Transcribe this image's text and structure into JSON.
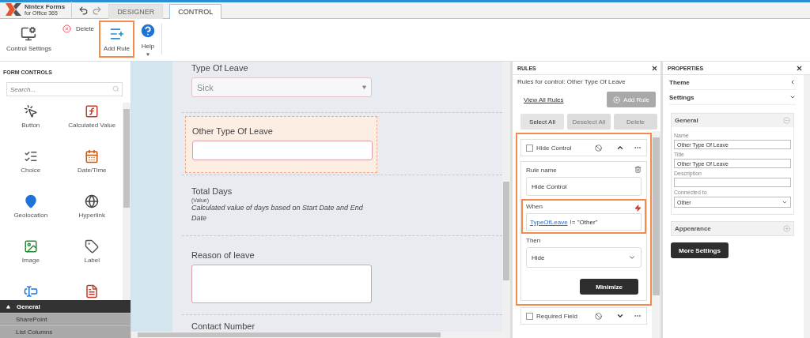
{
  "app": {
    "logo": {
      "name": "Nintex Forms",
      "subtitle": "for Office 365"
    },
    "tabs": [
      {
        "label": "DESIGNER",
        "selected": false
      },
      {
        "label": "CONTROL",
        "selected": true
      }
    ]
  },
  "ribbon": {
    "buttons": [
      {
        "kind": "settings",
        "label": "Control Settings",
        "highlighted": false
      },
      {
        "kind": "delete",
        "label": "Delete",
        "highlighted": false
      },
      {
        "kind": "add_rule",
        "label": "Add Rule",
        "highlighted": true
      },
      {
        "kind": "help",
        "label": "Help",
        "highlighted": false
      }
    ]
  },
  "form_controls": {
    "title": "FORM CONTROLS",
    "search": {
      "placeholder": "Search..."
    },
    "items": [
      {
        "kind": "button",
        "label": "Button"
      },
      {
        "kind": "calculated",
        "label": "Calculated Value"
      },
      {
        "kind": "choice",
        "label": "Choice"
      },
      {
        "kind": "datetime",
        "label": "Date/Time"
      },
      {
        "kind": "geolocation",
        "label": "Geolocation"
      },
      {
        "kind": "hyperlink",
        "label": "Hyperlink"
      },
      {
        "kind": "image",
        "label": "Image"
      },
      {
        "kind": "label",
        "label": "Label"
      },
      {
        "kind": "textbox"
      },
      {
        "kind": "pdf"
      }
    ],
    "category": {
      "label": "General",
      "expanded": true,
      "items": [
        "SharePoint",
        "List Columns"
      ]
    }
  },
  "form": {
    "sections": [
      {
        "kind": "select",
        "label": "Type Of Leave",
        "value": "Sick",
        "selected": false
      },
      {
        "kind": "text",
        "label": "Other Type Of Leave",
        "selected": true
      },
      {
        "kind": "calculated",
        "label": "Total Days",
        "hint": "(Value)",
        "description": "Calculated value of days based on Start Date and End Date",
        "selected": false
      },
      {
        "kind": "textarea",
        "label": "Reason of leave",
        "selected": false
      },
      {
        "kind": "heading",
        "label": "Contact Number",
        "selected": false
      }
    ]
  },
  "rules": {
    "title": "RULES",
    "subtitle": "Rules for control: Other Type Of Leave",
    "view_all": "View All Rules",
    "add_rule": {
      "label": "Add Rule",
      "disabled": true
    },
    "actions": [
      {
        "label": "Select All",
        "disabled": false
      },
      {
        "label": "Deselect All",
        "disabled": true
      },
      {
        "label": "Delete",
        "disabled": true
      }
    ],
    "highlighted": true,
    "items": [
      {
        "name": "Hide Control",
        "checked": false,
        "expanded": true,
        "rule_name_label": "Rule name",
        "rule_name": "Hide Control",
        "when_label": "When",
        "when_highlighted": true,
        "condition_field": "TypeOfLeave",
        "condition_text": "!= \"Other\"",
        "then_label": "Then",
        "then_value": "Hide",
        "minimize": "Minimize"
      },
      {
        "name": "Required Field",
        "checked": false,
        "expanded": false
      }
    ]
  },
  "properties": {
    "title": "PROPERTIES",
    "sections": [
      {
        "label": "Theme",
        "expanded": false
      },
      {
        "label": "Settings",
        "expanded": true
      }
    ],
    "groups": [
      {
        "label": "General",
        "expanded": true,
        "fields": [
          {
            "kind": "input",
            "label": "Name",
            "value": "Other Type Of Leave"
          },
          {
            "kind": "input",
            "label": "Title",
            "value": "Other Type Of Leave"
          },
          {
            "kind": "input",
            "label": "Description"
          },
          {
            "kind": "select",
            "label": "Connected to",
            "value": "Other"
          }
        ]
      },
      {
        "label": "Appearance",
        "expanded": false
      }
    ],
    "more_settings": "More Settings"
  }
}
